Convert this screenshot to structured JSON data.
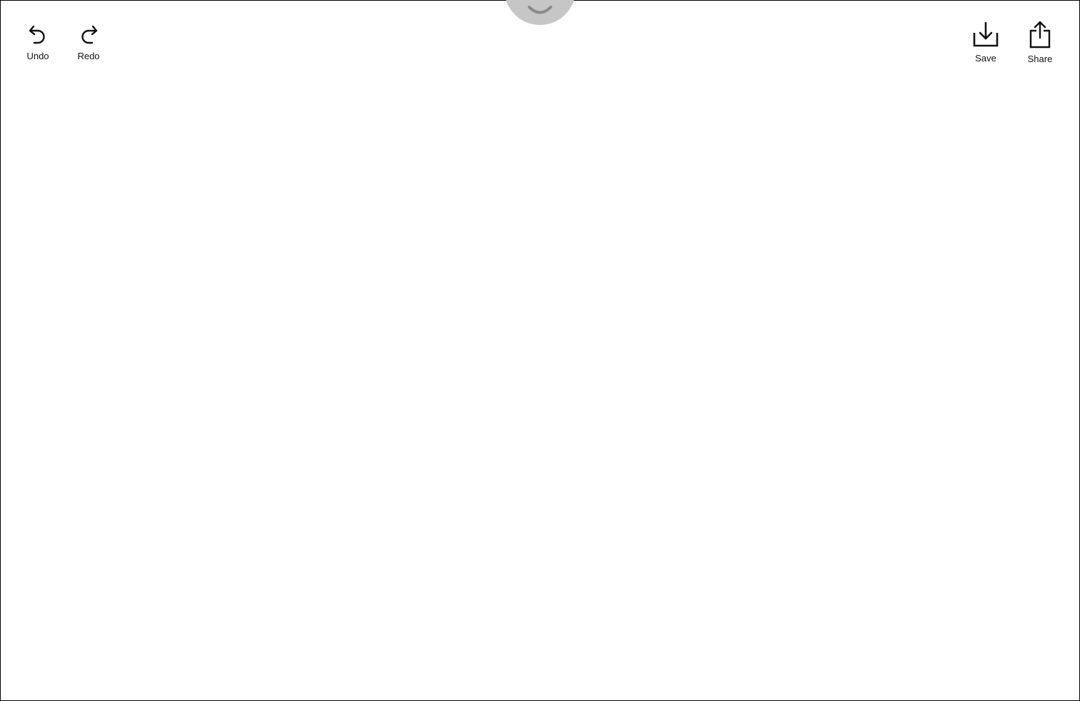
{
  "toolbar": {
    "undo_label": "Undo",
    "redo_label": "Redo",
    "save_label": "Save",
    "share_label": "Share"
  },
  "icons": {
    "undo": "undo-arrow-icon",
    "redo": "redo-arrow-icon",
    "save": "download-tray-icon",
    "share": "share-up-arrow-icon",
    "handle": "chevron-down-icon"
  },
  "colors": {
    "background": "#ffffff",
    "icon": "#111111",
    "handle": "#c6c6c6",
    "handle_chevron": "#8a8a8a",
    "border": "#000000"
  }
}
